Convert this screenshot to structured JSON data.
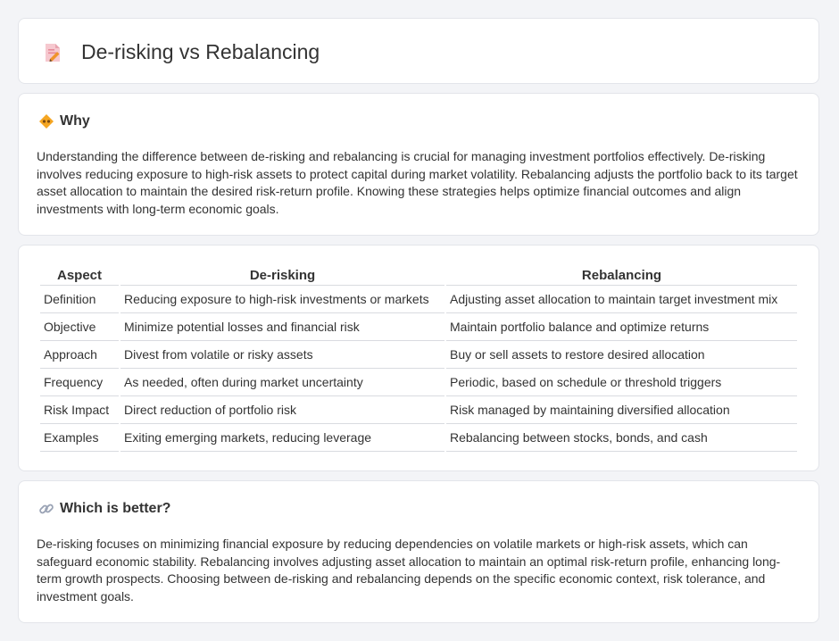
{
  "header": {
    "title": "De-risking vs Rebalancing",
    "icon": "document-pencil-icon"
  },
  "why": {
    "title": "Why",
    "icon": "diamond-sign-icon",
    "body": "Understanding the difference between de-risking and rebalancing is crucial for managing investment portfolios effectively. De-risking involves reducing exposure to high-risk assets to protect capital during market volatility. Rebalancing adjusts the portfolio back to its target asset allocation to maintain the desired risk-return profile. Knowing these strategies helps optimize financial outcomes and align investments with long-term economic goals."
  },
  "table": {
    "headers": [
      "Aspect",
      "De-risking",
      "Rebalancing"
    ],
    "rows": [
      [
        "Definition",
        "Reducing exposure to high-risk investments or markets",
        "Adjusting asset allocation to maintain target investment mix"
      ],
      [
        "Objective",
        "Minimize potential losses and financial risk",
        "Maintain portfolio balance and optimize returns"
      ],
      [
        "Approach",
        "Divest from volatile or risky assets",
        "Buy or sell assets to restore desired allocation"
      ],
      [
        "Frequency",
        "As needed, often during market uncertainty",
        "Periodic, based on schedule or threshold triggers"
      ],
      [
        "Risk Impact",
        "Direct reduction of portfolio risk",
        "Risk managed by maintaining diversified allocation"
      ],
      [
        "Examples",
        "Exiting emerging markets, reducing leverage",
        "Rebalancing between stocks, bonds, and cash"
      ]
    ]
  },
  "better": {
    "title": "Which is better?",
    "icon": "link-icon",
    "body": "De-risking focuses on minimizing financial exposure by reducing dependencies on volatile markets or high-risk assets, which can safeguard economic stability. Rebalancing involves adjusting asset allocation to maintain an optimal risk-return profile, enhancing long-term growth prospects. Choosing between de-risking and rebalancing depends on the specific economic context, risk tolerance, and investment goals."
  },
  "colors": {
    "background": "#f3f4f7",
    "card": "#ffffff",
    "accent_orange": "#f0932b",
    "pink": "#e8808f"
  }
}
